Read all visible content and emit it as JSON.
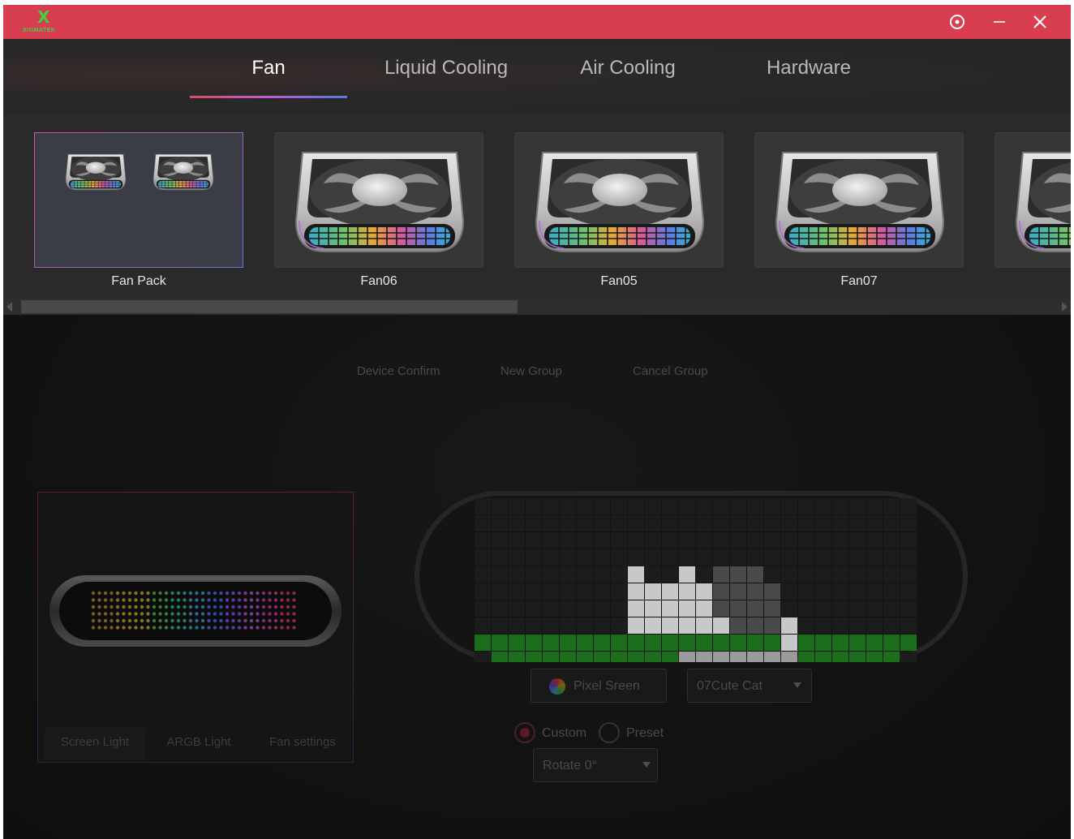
{
  "window": {
    "brand": "XIGMATEK",
    "controls": [
      "target-icon",
      "minimize-icon",
      "close-icon"
    ],
    "titlebar_color": "#d83d50"
  },
  "nav": {
    "tabs": [
      {
        "label": "Fan",
        "active": true
      },
      {
        "label": "Liquid Cooling",
        "active": false
      },
      {
        "label": "Air Cooling",
        "active": false
      },
      {
        "label": "Hardware",
        "active": false
      }
    ]
  },
  "devices": [
    {
      "label": "Fan Pack",
      "selected": true
    },
    {
      "label": "Fan06",
      "selected": false
    },
    {
      "label": "Fan05",
      "selected": false
    },
    {
      "label": "Fan07",
      "selected": false
    }
  ],
  "actions": {
    "device_confirm": "Device Confirm",
    "new_group": "New Group",
    "cancel_group": "Cancel Group"
  },
  "preview_tabs": {
    "screen_light": "Screen Light",
    "argb_light": "ARGB Light",
    "fan_settings": "Fan settings"
  },
  "controls": {
    "pixel_screen": "Pixel Sreen",
    "animation": "07Cute Cat",
    "custom": "Custom",
    "preset": "Preset",
    "mode_selected": "Custom",
    "rotate": "Rotate 0°"
  },
  "pixel_grid": {
    "columns": 26,
    "rows": 11,
    "colors": {
      "light": "#c8c8c8",
      "mid": "#9a9a9a",
      "dark": "#4a4a4a",
      "green": "#1c6e1c",
      "off": "#1c1c1c"
    },
    "rows_data": [
      "..........................",
      "..........................",
      "..........................",
      "..........................",
      ".........L..L.DDD.........",
      ".........LLLLLDDDD........",
      ".........LLLLLDDDD........",
      ".........LLLLLLDDDL.......",
      "GGGGGGGGGGGGGGGGGGLGGGGGGG",
      ".GGGGGGGGGGGMMMMMMMGGGGGG.",
      ".........................."
    ]
  }
}
